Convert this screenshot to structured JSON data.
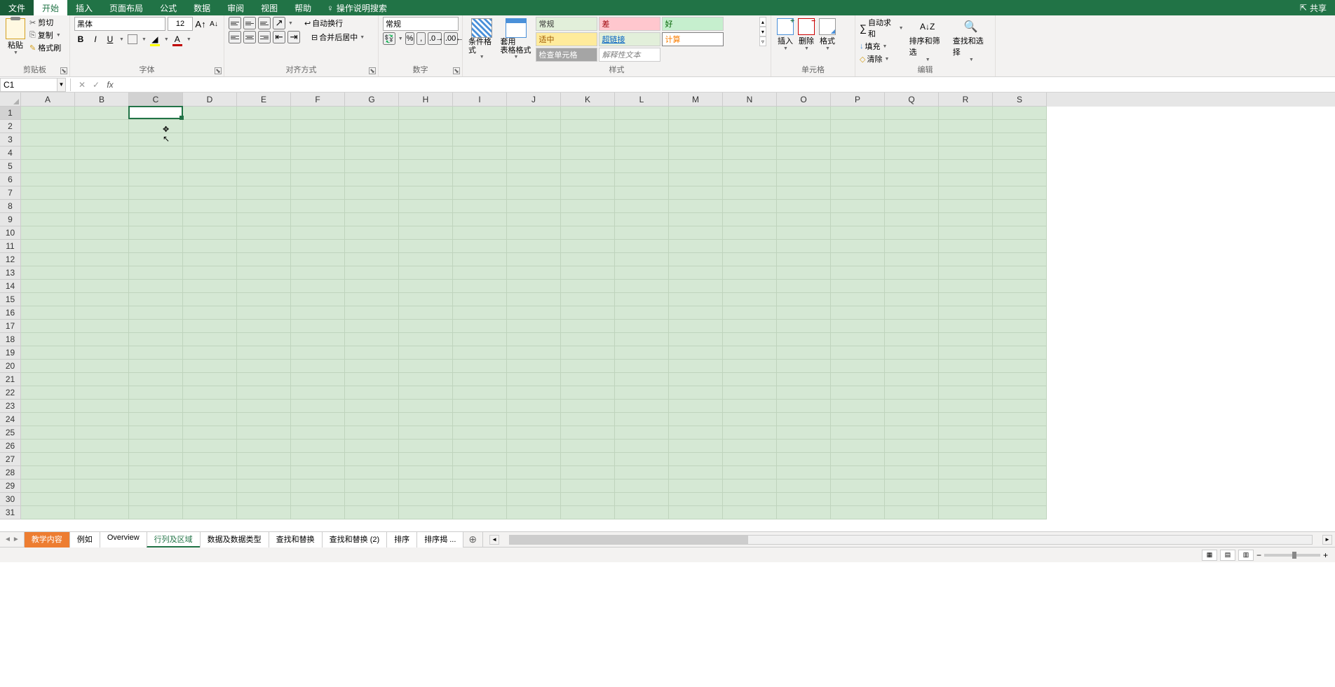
{
  "menu": {
    "file": "文件",
    "home": "开始",
    "insert": "插入",
    "page_layout": "页面布局",
    "formulas": "公式",
    "data": "数据",
    "review": "审阅",
    "view": "视图",
    "help": "帮助",
    "tell_me": "操作说明搜索",
    "share": "共享"
  },
  "ribbon": {
    "clipboard": {
      "label": "剪贴板",
      "paste": "粘贴",
      "cut": "剪切",
      "copy": "复制",
      "painter": "格式刷"
    },
    "font": {
      "label": "字体",
      "name": "黑体",
      "size": "12"
    },
    "alignment": {
      "label": "对齐方式",
      "wrap": "自动换行",
      "merge": "合并后居中"
    },
    "number": {
      "label": "数字",
      "format": "常规"
    },
    "styles": {
      "label": "样式",
      "conditional": "条件格式",
      "table_format": "套用\n表格格式",
      "cells": {
        "normal": "常规",
        "bad": "差",
        "good": "好",
        "neutral": "适中",
        "hyperlink": "超链接",
        "calculation": "计算",
        "check_cell": "检查单元格",
        "explanatory": "解释性文本"
      }
    },
    "cells_group": {
      "label": "单元格",
      "insert": "插入",
      "delete": "删除",
      "format": "格式"
    },
    "editing": {
      "label": "编辑",
      "auto_sum": "自动求和",
      "fill": "填充",
      "clear": "清除",
      "sort_filter": "排序和筛选",
      "find_select": "查找和选择"
    }
  },
  "name_box": "C1",
  "columns": [
    "A",
    "B",
    "C",
    "D",
    "E",
    "F",
    "G",
    "H",
    "I",
    "J",
    "K",
    "L",
    "M",
    "N",
    "O",
    "P",
    "Q",
    "R",
    "S"
  ],
  "rows": [
    1,
    2,
    3,
    4,
    5,
    6,
    7,
    8,
    9,
    10,
    11,
    12,
    13,
    14,
    15,
    16,
    17,
    18,
    19,
    20,
    21,
    22,
    23,
    24,
    25,
    26,
    27,
    28,
    29,
    30,
    31
  ],
  "active_cell": {
    "col": "C",
    "row": 1
  },
  "sheets": {
    "items": [
      {
        "name": "教学内容",
        "style": "orange"
      },
      {
        "name": "例如"
      },
      {
        "name": "Overview"
      },
      {
        "name": "行列及区域",
        "style": "green-text active"
      },
      {
        "name": "数据及数据类型"
      },
      {
        "name": "查找和替换"
      },
      {
        "name": "查找和替换 (2)"
      },
      {
        "name": "排序"
      },
      {
        "name": "排序揭 ..."
      }
    ]
  }
}
